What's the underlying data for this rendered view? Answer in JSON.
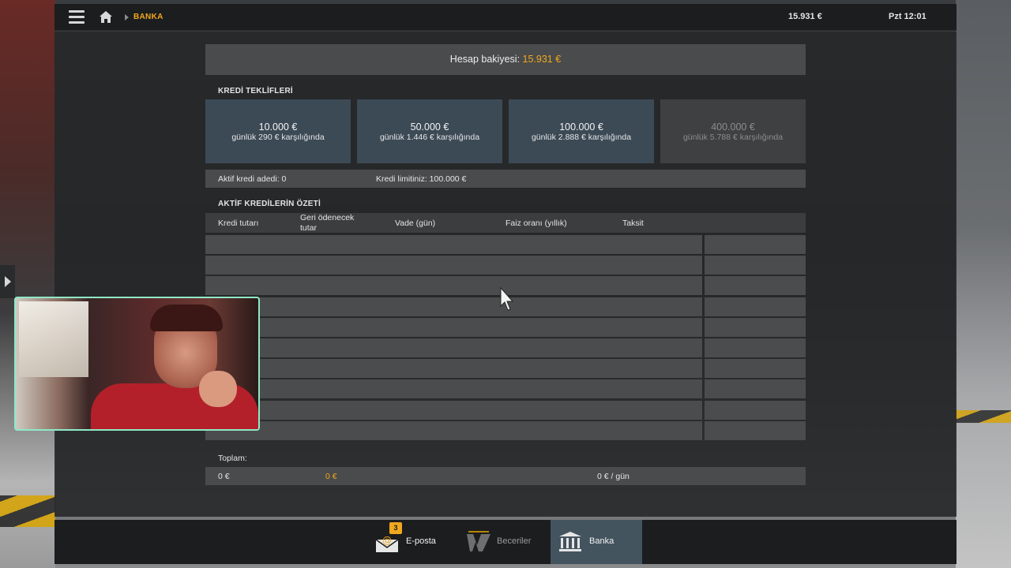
{
  "topbar": {
    "breadcrumb": "BANKA",
    "money": "15.931 €",
    "clock": "Pzt 12:01"
  },
  "balance": {
    "label": "Hesap bakiyesi: ",
    "amount": "15.931 €"
  },
  "offers_section": {
    "title": "KREDİ TEKLİFLERİ",
    "offers": [
      {
        "amount": "10.000 €",
        "daily": "günlük 290 € karşılığında",
        "enabled": true
      },
      {
        "amount": "50.000 €",
        "daily": "günlük 1.446 € karşılığında",
        "enabled": true
      },
      {
        "amount": "100.000 €",
        "daily": "günlük 2.888 € karşılığında",
        "enabled": true
      },
      {
        "amount": "400.000 €",
        "daily": "günlük 5.788 € karşılığında",
        "enabled": false
      }
    ]
  },
  "info": {
    "active_count": "Aktif kredi adedi: 0",
    "limit": "Kredi limitiniz: 100.000 €"
  },
  "summary": {
    "title": "AKTİF KREDİLERİN ÖZETİ",
    "columns": [
      "Kredi tutarı",
      "Geri ödenecek tutar",
      "Vade (gün)",
      "Faiz oranı (yıllık)",
      "Taksit"
    ],
    "rows": [
      [],
      [],
      [],
      [],
      [],
      [],
      [],
      [],
      [],
      []
    ]
  },
  "totals": {
    "label": "Toplam:",
    "loan_total": "0 €",
    "repay_total": "0 €",
    "installment_total": "0 € / gün"
  },
  "dock": {
    "email_label": "E-posta",
    "email_badge": "3",
    "skills_label": "Beceriler",
    "bank_label": "Banka"
  },
  "colors": {
    "accent": "#f0a81e",
    "offer_bg": "#3c4a56",
    "active_dock": "#44545f"
  }
}
